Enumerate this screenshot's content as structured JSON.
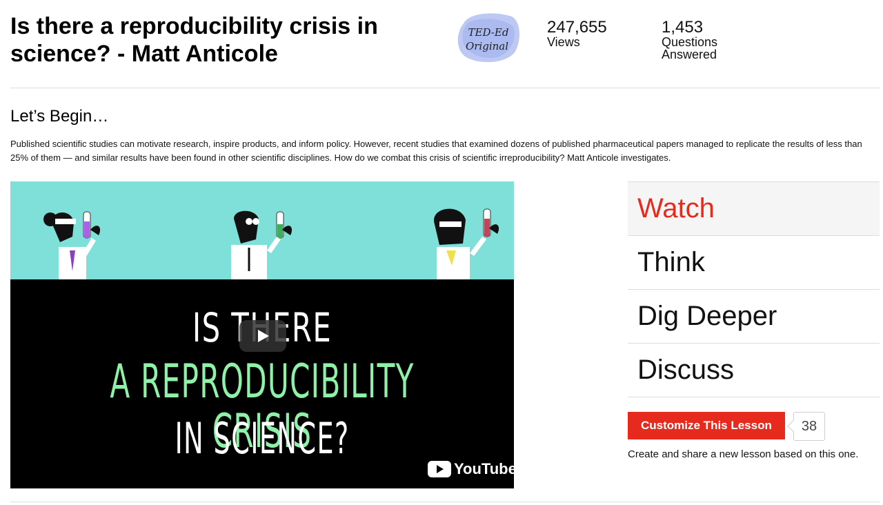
{
  "lesson": {
    "title_line1": "Is there a reproducibility crisis in",
    "title_line2": "science? - Matt Anticole"
  },
  "badge": {
    "line1": "TED-Ed",
    "line2": "Original",
    "color": "#a9b7f0"
  },
  "stats": {
    "views_count": "247,655",
    "views_label": "Views",
    "questions_count": "1,453",
    "questions_label1": "Questions",
    "questions_label2": "Answered"
  },
  "intro": {
    "heading": "Let’s Begin…",
    "text": "Published scientific studies can motivate research, inspire products, and inform policy. However, recent studies that examined dozens of published pharmaceutical papers managed to replicate the results of less than 25% of them — and similar results have been found in other scientific disciplines. How do we combat this crisis of scientific irreproducibility? Matt Anticole investigates."
  },
  "video": {
    "line1": "IS THERE",
    "line2": "A REPRODUCIBILITY CRISIS",
    "line3": "IN SCIENCE?",
    "youtube_label": "YouTube",
    "teal_color": "#7ee0d8",
    "green_color": "#8ff0a8"
  },
  "tabs": [
    {
      "label": "Watch",
      "active": true
    },
    {
      "label": "Think",
      "active": false
    },
    {
      "label": "Dig Deeper",
      "active": false
    },
    {
      "label": "Discuss",
      "active": false
    }
  ],
  "customize": {
    "button_label": "Customize This Lesson",
    "count": "38",
    "note": "Create and share a new lesson based on this one.",
    "accent_color": "#e62b1e"
  }
}
